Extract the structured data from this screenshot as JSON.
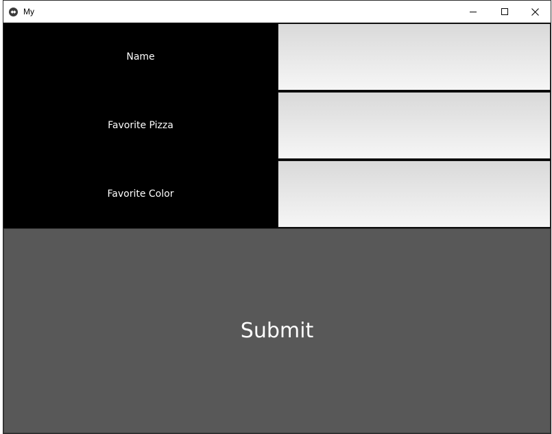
{
  "window": {
    "title": "My",
    "icon": "kivy-app-icon",
    "controls": {
      "minimize_icon": "minimize-icon",
      "maximize_icon": "maximize-icon",
      "close_icon": "close-icon"
    }
  },
  "form": {
    "fields": [
      {
        "label": "Name",
        "value": "",
        "placeholder": ""
      },
      {
        "label": "Favorite Pizza",
        "value": "",
        "placeholder": ""
      },
      {
        "label": "Favorite Color",
        "value": "",
        "placeholder": ""
      }
    ],
    "submit_label": "Submit"
  },
  "colors": {
    "label_background": "#000000",
    "label_text": "#ffffff",
    "submit_background": "#585858",
    "submit_text": "#ffffff"
  }
}
